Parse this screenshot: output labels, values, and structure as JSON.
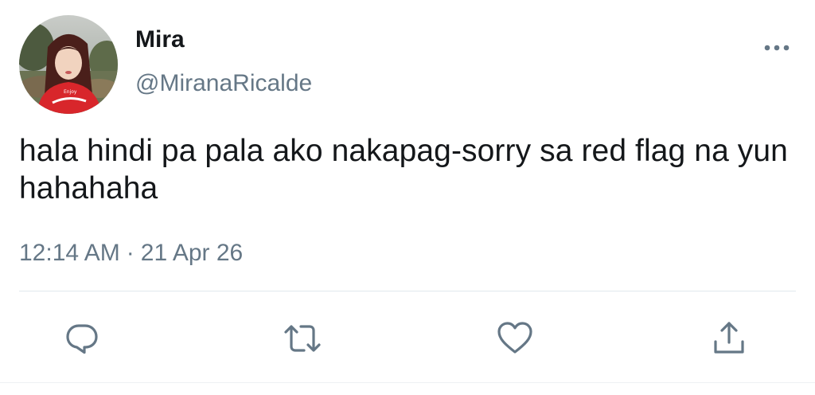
{
  "user": {
    "display_name": "Mira",
    "handle": "@MiranaRicalde"
  },
  "tweet": {
    "text": "hala hindi pa pala ako nakapag-sorry sa red flag na yun hahahaha",
    "time": "12:14 AM",
    "separator": "·",
    "date": "21 Apr 26"
  },
  "icons": {
    "more": "more-horizontal-icon",
    "reply": "reply-icon",
    "retweet": "retweet-icon",
    "like": "like-icon",
    "share": "share-icon"
  },
  "colors": {
    "text": "#14171a",
    "secondary": "#657786",
    "divider": "#e1e8ed"
  }
}
